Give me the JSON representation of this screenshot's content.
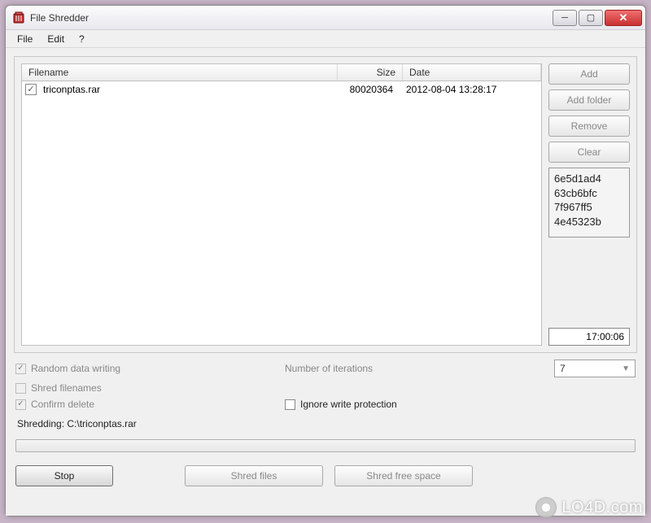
{
  "window": {
    "title": "File Shredder"
  },
  "menu": {
    "file": "File",
    "edit": "Edit",
    "help": "?"
  },
  "list": {
    "headers": {
      "filename": "Filename",
      "size": "Size",
      "date": "Date"
    },
    "rows": [
      {
        "filename": "triconptas.rar",
        "size": "80020364",
        "date": "2012-08-04 13:28:17",
        "checked": true
      }
    ]
  },
  "sidebuttons": {
    "add": "Add",
    "add_folder": "Add folder",
    "remove": "Remove",
    "clear": "Clear"
  },
  "hashbox": {
    "lines": [
      "6e5d1ad4",
      "63cb6bfc",
      "7f967ff5",
      "4e45323b"
    ]
  },
  "timer": "17:00:06",
  "options": {
    "random_data": "Random data writing",
    "iterations_label": "Number of iterations",
    "iterations_value": "7",
    "shred_filenames": "Shred filenames",
    "confirm_delete": "Confirm delete",
    "ignore_write_protection": "Ignore write protection"
  },
  "status": "Shredding: C:\\triconptas.rar",
  "bottom": {
    "stop": "Stop",
    "shred_files": "Shred files",
    "shred_free": "Shred free space"
  },
  "watermark": "LO4D.com"
}
